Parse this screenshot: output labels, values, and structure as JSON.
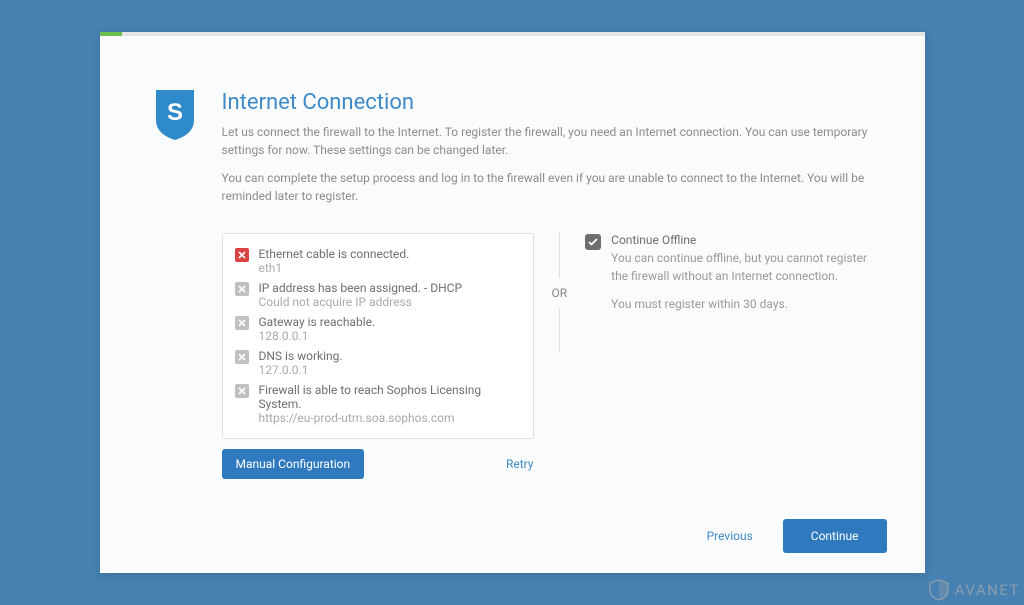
{
  "page": {
    "title": "Internet Connection",
    "desc1": "Let us connect the firewall to the Internet. To register the firewall, you need an Internet connection. You can use temporary settings for now. These settings can be changed later.",
    "desc2": "You can complete the setup process and log in to the firewall even if you are unable to connect to the Internet. You will be reminded later to register."
  },
  "status": [
    {
      "state": "error",
      "line1": "Ethernet cable is connected.",
      "line2": "eth1"
    },
    {
      "state": "neutral",
      "line1": "IP address has been assigned. - DHCP",
      "line2": "Could not acquire IP address"
    },
    {
      "state": "neutral",
      "line1": "Gateway is reachable.",
      "line2": "128.0.0.1"
    },
    {
      "state": "neutral",
      "line1": "DNS is working.",
      "line2": "127.0.0.1"
    },
    {
      "state": "neutral",
      "line1": "Firewall is able to reach Sophos Licensing System.",
      "line2": "https://eu-prod-utm.soa.sophos.com"
    }
  ],
  "buttons": {
    "manual": "Manual Configuration",
    "retry": "Retry",
    "previous": "Previous",
    "continue": "Continue"
  },
  "divider": {
    "or": "OR"
  },
  "offline": {
    "title": "Continue Offline",
    "desc": "You can continue offline, but you cannot register the firewall without an Internet connection.",
    "note": "You must register within 30 days."
  },
  "watermark": "AVANET"
}
